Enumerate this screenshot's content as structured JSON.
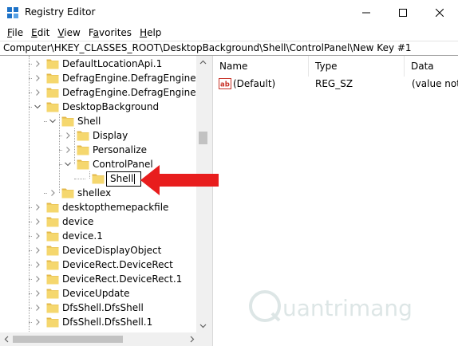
{
  "window": {
    "title": "Registry Editor",
    "controls": [
      "minimize",
      "maximize",
      "close"
    ]
  },
  "menu": {
    "items": [
      {
        "label": "File",
        "accel": "F"
      },
      {
        "label": "Edit",
        "accel": "E"
      },
      {
        "label": "View",
        "accel": "V"
      },
      {
        "label": "Favorites",
        "accel": "a"
      },
      {
        "label": "Help",
        "accel": "H"
      }
    ]
  },
  "address": {
    "path": "Computer\\HKEY_CLASSES_ROOT\\DesktopBackground\\Shell\\ControlPanel\\New Key #1"
  },
  "tree": {
    "items": [
      {
        "label": "DefaultLocationApi.1",
        "level": 0,
        "expander": "collapsed"
      },
      {
        "label": "DefragEngine.DefragEngine",
        "level": 0,
        "expander": "collapsed"
      },
      {
        "label": "DefragEngine.DefragEngine.1",
        "level": 0,
        "expander": "collapsed"
      },
      {
        "label": "DesktopBackground",
        "level": 0,
        "expander": "expanded"
      },
      {
        "label": "Shell",
        "level": 1,
        "expander": "expanded"
      },
      {
        "label": "Display",
        "level": 2,
        "expander": "collapsed"
      },
      {
        "label": "Personalize",
        "level": 2,
        "expander": "collapsed"
      },
      {
        "label": "ControlPanel",
        "level": 2,
        "expander": "expanded"
      },
      {
        "label": "Shell",
        "level": 3,
        "expander": "none",
        "editing": true
      },
      {
        "label": "shellex",
        "level": 1,
        "expander": "collapsed"
      },
      {
        "label": "desktopthemepackfile",
        "level": 0,
        "expander": "collapsed"
      },
      {
        "label": "device",
        "level": 0,
        "expander": "collapsed"
      },
      {
        "label": "device.1",
        "level": 0,
        "expander": "collapsed"
      },
      {
        "label": "DeviceDisplayObject",
        "level": 0,
        "expander": "collapsed"
      },
      {
        "label": "DeviceRect.DeviceRect",
        "level": 0,
        "expander": "collapsed"
      },
      {
        "label": "DeviceRect.DeviceRect.1",
        "level": 0,
        "expander": "collapsed"
      },
      {
        "label": "DeviceUpdate",
        "level": 0,
        "expander": "collapsed"
      },
      {
        "label": "DfsShell.DfsShell",
        "level": 0,
        "expander": "collapsed"
      },
      {
        "label": "DfsShell.DfsShell.1",
        "level": 0,
        "expander": "collapsed"
      }
    ]
  },
  "list": {
    "columns": [
      "Name",
      "Type",
      "Data"
    ],
    "rows": [
      {
        "icon": "string-value-icon",
        "name": "(Default)",
        "type": "REG_SZ",
        "data": "(value not"
      }
    ]
  },
  "watermark": {
    "text": "uantrimang"
  },
  "colors": {
    "folder": "#f5d76e",
    "folder_dark": "#e3b84a",
    "accent_arrow": "#e81d1d",
    "title_icon_blue": "#1e73c8",
    "ab_icon_red": "#c8342a"
  }
}
